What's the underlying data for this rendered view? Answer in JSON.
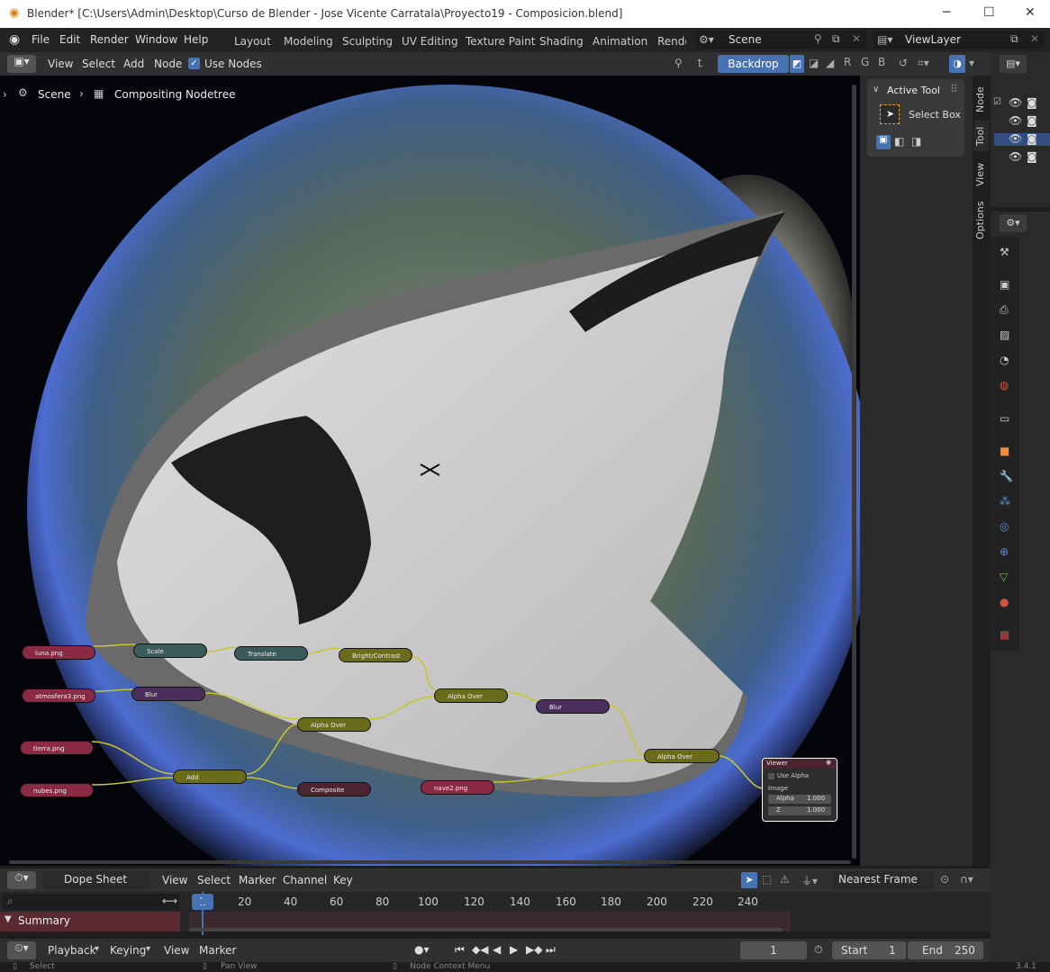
{
  "window": {
    "title": "Blender* [C:\\Users\\Admin\\Desktop\\Curso de Blender - Jose Vicente Carratala\\Proyecto19 - Composicion.blend]"
  },
  "menu": [
    "File",
    "Edit",
    "Render",
    "Window",
    "Help"
  ],
  "workspaces": [
    "Layout",
    "Modeling",
    "Sculpting",
    "UV Editing",
    "Texture Paint",
    "Shading",
    "Animation",
    "Rende"
  ],
  "scene": "Scene",
  "view_layer": "ViewLayer",
  "node_header": {
    "menus": [
      "View",
      "Select",
      "Add",
      "Node"
    ],
    "use_nodes": "Use Nodes",
    "backdrop": "Backdrop",
    "channels": [
      "R",
      "G",
      "B"
    ]
  },
  "breadcrumb": {
    "scene": "Scene",
    "tree": "Compositing Nodetree"
  },
  "side_panel": {
    "section": "Active Tool",
    "tool": "Select Box",
    "tabs": [
      "Node",
      "Tool",
      "View",
      "Options"
    ]
  },
  "nodes": [
    {
      "id": "n1",
      "label": "luna.png",
      "color": "#8a2a45"
    },
    {
      "id": "n2",
      "label": "Scale",
      "color": "#3b5a5c"
    },
    {
      "id": "n3",
      "label": "Translate",
      "color": "#3b5a5c"
    },
    {
      "id": "n4",
      "label": "Bright/Contrast",
      "color": "#6b6b1c"
    },
    {
      "id": "n5",
      "label": "atmosfera3.png",
      "color": "#8a2a45"
    },
    {
      "id": "n6",
      "label": "Blur",
      "color": "#4a2f5c"
    },
    {
      "id": "n7",
      "label": "Alpha Over",
      "color": "#6b6b1c"
    },
    {
      "id": "n8",
      "label": "Alpha Over",
      "color": "#6b6b1c"
    },
    {
      "id": "n9",
      "label": "Blur",
      "color": "#4a2f5c"
    },
    {
      "id": "n10",
      "label": "tierra.png",
      "color": "#8a2a45"
    },
    {
      "id": "n11",
      "label": "Add",
      "color": "#6b6b1c"
    },
    {
      "id": "n12",
      "label": "Composite",
      "color": "#4a2430"
    },
    {
      "id": "n13",
      "label": "nubes.png",
      "color": "#8a2a45"
    },
    {
      "id": "n14",
      "label": "nave2.png",
      "color": "#8a2a45"
    },
    {
      "id": "n15",
      "label": "Alpha Over",
      "color": "#6b6b1c"
    }
  ],
  "viewer": {
    "title": "Viewer",
    "use_alpha": "Use Alpha",
    "image": "Image",
    "alpha_label": "Alpha",
    "alpha_value": "1.000",
    "z_label": "Z",
    "z_value": "1.000"
  },
  "dopesheet": {
    "mode": "Dope Sheet",
    "menus": [
      "View",
      "Select",
      "Marker",
      "Channel",
      "Key"
    ],
    "snap": "Nearest Frame",
    "summary": "Summary",
    "current_frame_marker": "1",
    "ruler": [
      "20",
      "40",
      "60",
      "80",
      "100",
      "120",
      "140",
      "160",
      "180",
      "200",
      "220",
      "240"
    ]
  },
  "timeline": {
    "playback": "Playback",
    "keying": "Keying",
    "view": "View",
    "marker": "Marker",
    "frame": "1",
    "start_label": "Start",
    "start": "1",
    "end_label": "End",
    "end": "250"
  },
  "status": {
    "select": "Select",
    "pan": "Pan View",
    "context": "Node Context Menu",
    "version": "3.4.1"
  }
}
